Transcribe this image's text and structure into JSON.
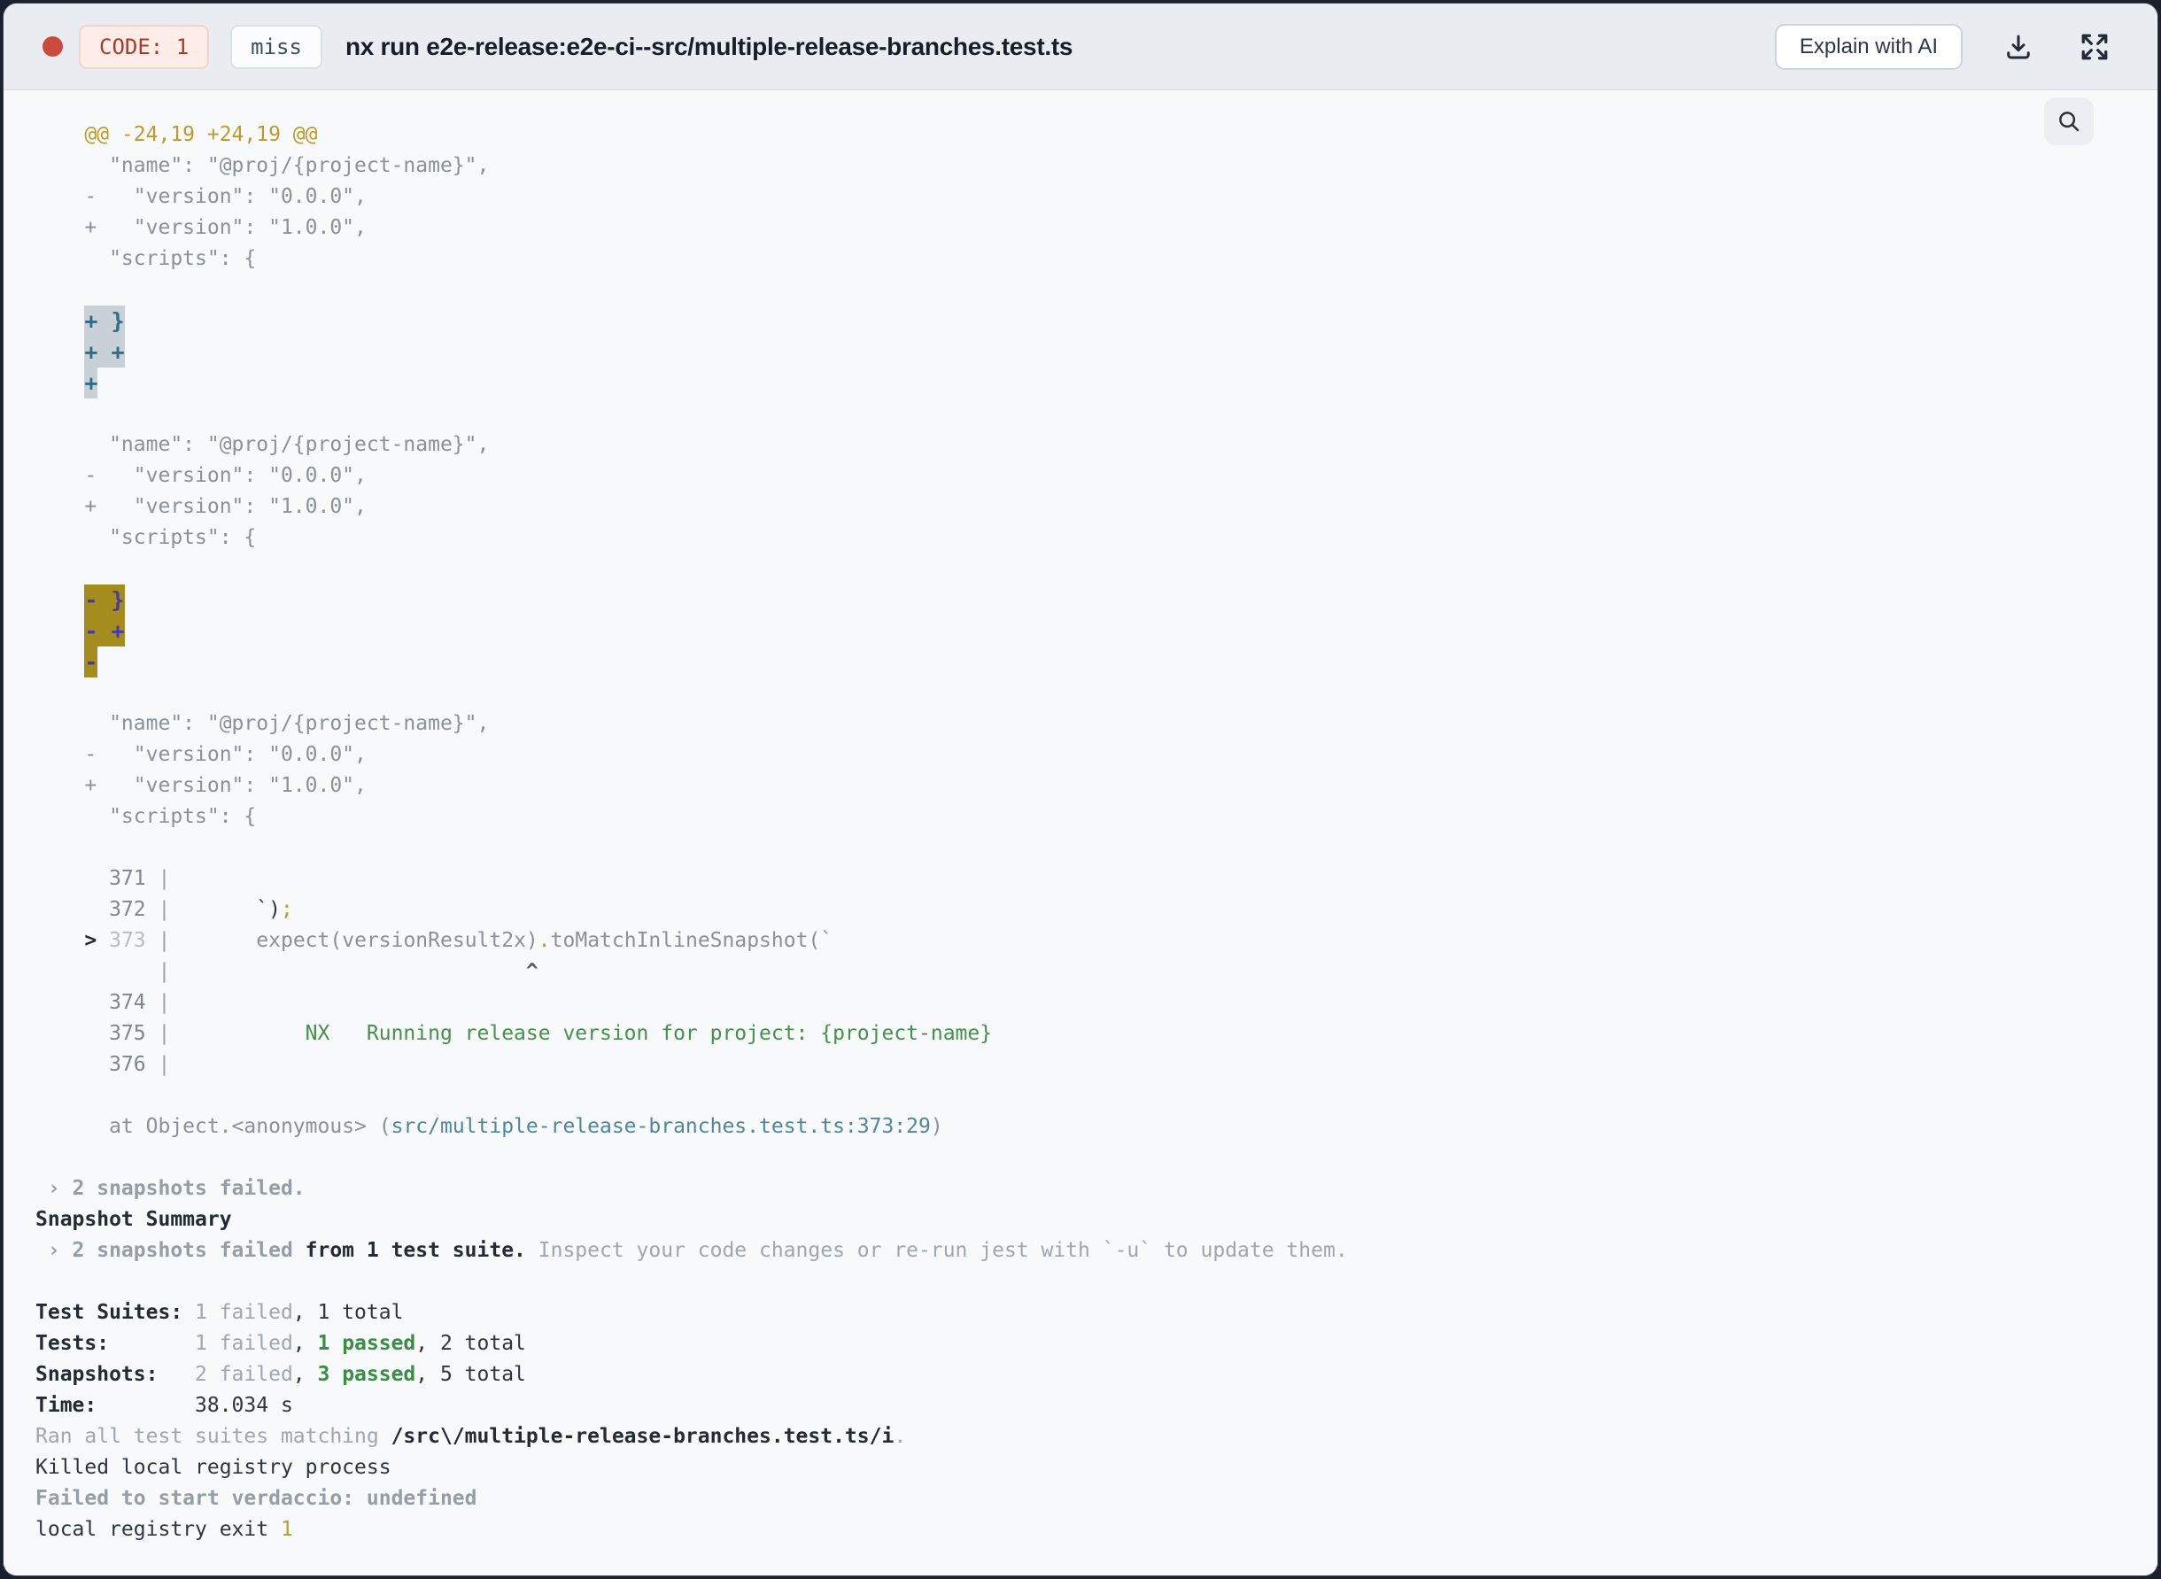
{
  "window": {
    "header": {
      "status_dot_color": "#cb4a3b",
      "exit_code_badge": "CODE: 1",
      "cache_badge": "miss",
      "title": "nx run e2e-release:e2e-ci--src/multiple-release-branches.test.ts",
      "explain_button_label": "Explain with AI",
      "icons": [
        "download-icon",
        "fullscreen-icon"
      ]
    },
    "terminal": {
      "search_icon": "magnifier",
      "colors": {
        "diff_header": "#bf9a2a",
        "diff_text": "#8b9199",
        "added_highlight_bg": "#c9d1d8",
        "added_highlight_text": "#2f6c89",
        "removed_highlight_bg": "#a58d1d",
        "removed_highlight_text": "#4939ad",
        "passed_green": "#3a8d44",
        "link_teal": "#4f8799"
      },
      "lines": [
        [
          {
            "c": "plain",
            "t": "    "
          },
          {
            "c": "gold",
            "t": "@@ -24,19 +24,19 @@"
          }
        ],
        [
          {
            "c": "gray",
            "t": "      \"name\": \"@proj/{project-name}\","
          }
        ],
        [
          {
            "c": "gray",
            "t": "    -   \"version\": \"0.0.0\","
          }
        ],
        [
          {
            "c": "gray",
            "t": "    +   \"version\": \"1.0.0\","
          }
        ],
        [
          {
            "c": "gray",
            "t": "      \"scripts\": {"
          }
        ],
        [],
        [
          {
            "c": "plain",
            "t": "    "
          },
          {
            "c": "hl-add",
            "t": "+ }"
          }
        ],
        [
          {
            "c": "plain",
            "t": "    "
          },
          {
            "c": "hl-add",
            "t": "+ +"
          }
        ],
        [
          {
            "c": "plain",
            "t": "    "
          },
          {
            "c": "hl-add",
            "t": "+"
          }
        ],
        [],
        [
          {
            "c": "gray",
            "t": "      \"name\": \"@proj/{project-name}\","
          }
        ],
        [
          {
            "c": "gray",
            "t": "    -   \"version\": \"0.0.0\","
          }
        ],
        [
          {
            "c": "gray",
            "t": "    +   \"version\": \"1.0.0\","
          }
        ],
        [
          {
            "c": "gray",
            "t": "      \"scripts\": {"
          }
        ],
        [],
        [
          {
            "c": "plain",
            "t": "    "
          },
          {
            "c": "hl-del",
            "t": "- }"
          }
        ],
        [
          {
            "c": "plain",
            "t": "    "
          },
          {
            "c": "hl-del",
            "t": "- +"
          }
        ],
        [
          {
            "c": "plain",
            "t": "    "
          },
          {
            "c": "hl-del",
            "t": "-"
          }
        ],
        [],
        [
          {
            "c": "gray",
            "t": "      \"name\": \"@proj/{project-name}\","
          }
        ],
        [
          {
            "c": "gray",
            "t": "    -   \"version\": \"0.0.0\","
          }
        ],
        [
          {
            "c": "gray",
            "t": "    +   \"version\": \"1.0.0\","
          }
        ],
        [
          {
            "c": "gray",
            "t": "      \"scripts\": {"
          }
        ],
        [],
        [
          {
            "c": "lnum",
            "t": "      371"
          },
          {
            "c": "pipe",
            "t": " |"
          }
        ],
        [
          {
            "c": "lnum",
            "t": "      372"
          },
          {
            "c": "pipe",
            "t": " |"
          },
          {
            "c": "plain",
            "t": "       "
          },
          {
            "c": "dark",
            "t": "`)"
          },
          {
            "c": "gold",
            "t": ";"
          }
        ],
        [
          {
            "c": "plain",
            "t": "    "
          },
          {
            "c": "darkb",
            "t": ">"
          },
          {
            "c": "plain",
            "t": " "
          },
          {
            "c": "dim",
            "t": "373"
          },
          {
            "c": "pipe",
            "t": " |"
          },
          {
            "c": "plain",
            "t": "       "
          },
          {
            "c": "gray",
            "t": "expect(versionResult2x)"
          },
          {
            "c": "gold",
            "t": "."
          },
          {
            "c": "gray",
            "t": "toMatchInlineSnapshot(`"
          }
        ],
        [
          {
            "c": "plain",
            "t": "          "
          },
          {
            "c": "pipe",
            "t": "|"
          },
          {
            "c": "plain",
            "t": "                             "
          },
          {
            "c": "caret",
            "t": "^"
          }
        ],
        [
          {
            "c": "lnum",
            "t": "      374"
          },
          {
            "c": "pipe",
            "t": " |"
          }
        ],
        [
          {
            "c": "lnum",
            "t": "      375"
          },
          {
            "c": "pipe",
            "t": " |"
          },
          {
            "c": "plain",
            "t": "           "
          },
          {
            "c": "green",
            "t": "NX   Running release version for project: {project-name}"
          }
        ],
        [
          {
            "c": "lnum",
            "t": "      376"
          },
          {
            "c": "pipe",
            "t": " |"
          }
        ],
        [],
        [
          {
            "c": "gray",
            "t": "      at Object.<anonymous> ("
          },
          {
            "c": "teal",
            "t": "src/multiple-release-branches.test.ts:373:29"
          },
          {
            "c": "gray",
            "t": ")"
          }
        ],
        [],
        [
          {
            "c": "grayb",
            "t": " › 2 snapshots failed."
          }
        ],
        [
          {
            "c": "darkb",
            "t": "Snapshot Summary"
          }
        ],
        [
          {
            "c": "grayb",
            "t": " › 2 snapshots failed"
          },
          {
            "c": "darkb",
            "t": " from 1 test suite."
          },
          {
            "c": "gray2",
            "t": " Inspect your code changes or re-run jest with `-u` to update them."
          }
        ],
        [],
        [
          {
            "c": "darkb",
            "t": "Test Suites: "
          },
          {
            "c": "gray2",
            "t": "1 failed"
          },
          {
            "c": "dark",
            "t": ", 1 total"
          }
        ],
        [
          {
            "c": "darkb",
            "t": "Tests:       "
          },
          {
            "c": "gray2",
            "t": "1 failed"
          },
          {
            "c": "dark",
            "t": ", "
          },
          {
            "c": "greenb",
            "t": "1 passed"
          },
          {
            "c": "dark",
            "t": ", 2 total"
          }
        ],
        [
          {
            "c": "darkb",
            "t": "Snapshots:   "
          },
          {
            "c": "gray2",
            "t": "2 failed"
          },
          {
            "c": "dark",
            "t": ", "
          },
          {
            "c": "greenb",
            "t": "3 passed"
          },
          {
            "c": "dark",
            "t": ", 5 total"
          }
        ],
        [
          {
            "c": "darkb",
            "t": "Time:        "
          },
          {
            "c": "dark",
            "t": "38.034 s"
          }
        ],
        [
          {
            "c": "gray2",
            "t": "Ran all test suites matching "
          },
          {
            "c": "darkb",
            "t": "/src\\/multiple-release-branches.test.ts/i"
          },
          {
            "c": "gray2",
            "t": "."
          }
        ],
        [
          {
            "c": "dark",
            "t": "Killed local registry process"
          }
        ],
        [
          {
            "c": "grayb",
            "t": "Failed to start verdaccio: undefined"
          }
        ],
        [
          {
            "c": "dark",
            "t": "local registry exit "
          },
          {
            "c": "gold",
            "t": "1"
          }
        ]
      ]
    }
  }
}
